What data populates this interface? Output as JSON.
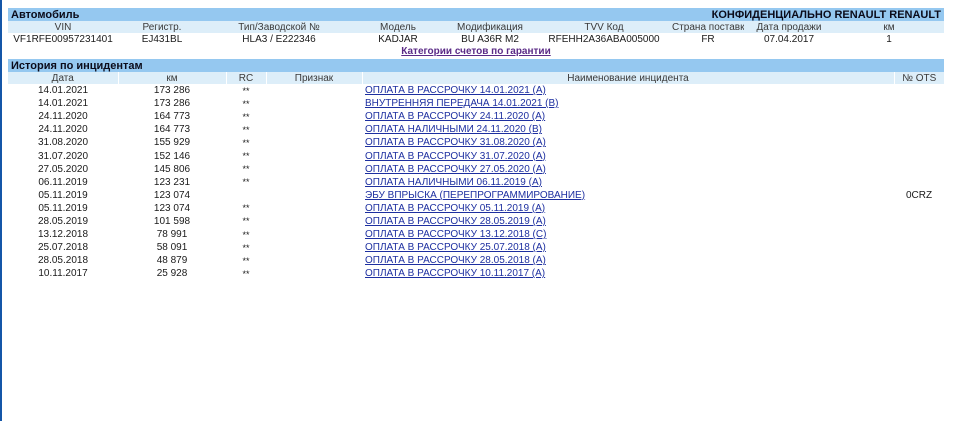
{
  "vehicle": {
    "section_title": "Автомобиль",
    "confidential": "КОНФИДЕНЦИАЛЬНО RENAULT RENAULT",
    "headers": {
      "vin": "VIN",
      "reg": "Регистр.",
      "type": "Тип/Заводской №",
      "model": "Модель",
      "mod": "Модификация",
      "tvv": "TVV Код",
      "country": "Страна поставки",
      "sale_date": "Дата продажи",
      "km": "км"
    },
    "values": {
      "vin": "VF1RFE00957231401",
      "reg": "EJ431BL",
      "type": "HLA3 / E222346",
      "model": "KADJAR",
      "mod": "BU A36R M2",
      "tvv": "RFEHH2A36ABA005000",
      "country": "FR",
      "sale_date": "07.04.2017",
      "km": "1"
    },
    "warranty_link": "Категории счетов по гарантии"
  },
  "history": {
    "section_title": "История по инцидентам",
    "headers": {
      "date": "Дата",
      "km": "км",
      "rc": "RC",
      "sign": "Признак",
      "name": "Наименование инцидента",
      "ots": "№ OTS"
    },
    "rows": [
      {
        "date": "14.01.2021",
        "km": "173 286",
        "rc": "**",
        "sign": "",
        "name": "ОПЛАТА В РАССРОЧКУ 14.01.2021 (A)",
        "ots": ""
      },
      {
        "date": "14.01.2021",
        "km": "173 286",
        "rc": "**",
        "sign": "",
        "name": "ВНУТРЕННЯЯ ПЕРЕДАЧА 14.01.2021 (B)",
        "ots": ""
      },
      {
        "date": "24.11.2020",
        "km": "164 773",
        "rc": "**",
        "sign": "",
        "name": "ОПЛАТА В РАССРОЧКУ 24.11.2020 (A)",
        "ots": ""
      },
      {
        "date": "24.11.2020",
        "km": "164 773",
        "rc": "**",
        "sign": "",
        "name": "ОПЛАТА НАЛИЧНЫМИ 24.11.2020 (B)",
        "ots": ""
      },
      {
        "date": "31.08.2020",
        "km": "155 929",
        "rc": "**",
        "sign": "",
        "name": "ОПЛАТА В РАССРОЧКУ 31.08.2020 (A)",
        "ots": ""
      },
      {
        "date": "31.07.2020",
        "km": "152 146",
        "rc": "**",
        "sign": "",
        "name": "ОПЛАТА В РАССРОЧКУ 31.07.2020 (A)",
        "ots": ""
      },
      {
        "date": "27.05.2020",
        "km": "145 806",
        "rc": "**",
        "sign": "",
        "name": "ОПЛАТА В РАССРОЧКУ 27.05.2020 (A)",
        "ots": ""
      },
      {
        "date": "06.11.2019",
        "km": "123 231",
        "rc": "**",
        "sign": "",
        "name": "ОПЛАТА НАЛИЧНЫМИ 06.11.2019 (A)",
        "ots": ""
      },
      {
        "date": "05.11.2019",
        "km": "123 074",
        "rc": "",
        "sign": "",
        "name": "ЭБУ ВПРЫСКА (ПЕРЕПРОГРАММИРОВАНИЕ)",
        "ots": "0CRZ"
      },
      {
        "date": "05.11.2019",
        "km": "123 074",
        "rc": "**",
        "sign": "",
        "name": "ОПЛАТА В РАССРОЧКУ 05.11.2019 (A)",
        "ots": ""
      },
      {
        "date": "28.05.2019",
        "km": "101 598",
        "rc": "**",
        "sign": "",
        "name": "ОПЛАТА В РАССРОЧКУ 28.05.2019 (A)",
        "ots": ""
      },
      {
        "date": "13.12.2018",
        "km": "78 991",
        "rc": "**",
        "sign": "",
        "name": "ОПЛАТА В РАССРОЧКУ 13.12.2018 (C)",
        "ots": ""
      },
      {
        "date": "25.07.2018",
        "km": "58 091",
        "rc": "**",
        "sign": "",
        "name": "ОПЛАТА В РАССРОЧКУ 25.07.2018 (A)",
        "ots": ""
      },
      {
        "date": "28.05.2018",
        "km": "48 879",
        "rc": "**",
        "sign": "",
        "name": "ОПЛАТА В РАССРОЧКУ 28.05.2018 (A)",
        "ots": ""
      },
      {
        "date": "10.11.2017",
        "km": "25 928",
        "rc": "**",
        "sign": "",
        "name": "ОПЛАТА В РАССРОЧКУ 10.11.2017 (A)",
        "ots": ""
      }
    ]
  },
  "colors": {
    "section_bar": "#95c8f0",
    "header_row": "#ddeef9",
    "incident_link": "#1d2fa0",
    "warranty_link": "#5a2a86",
    "window_edge": "#1456a8"
  }
}
